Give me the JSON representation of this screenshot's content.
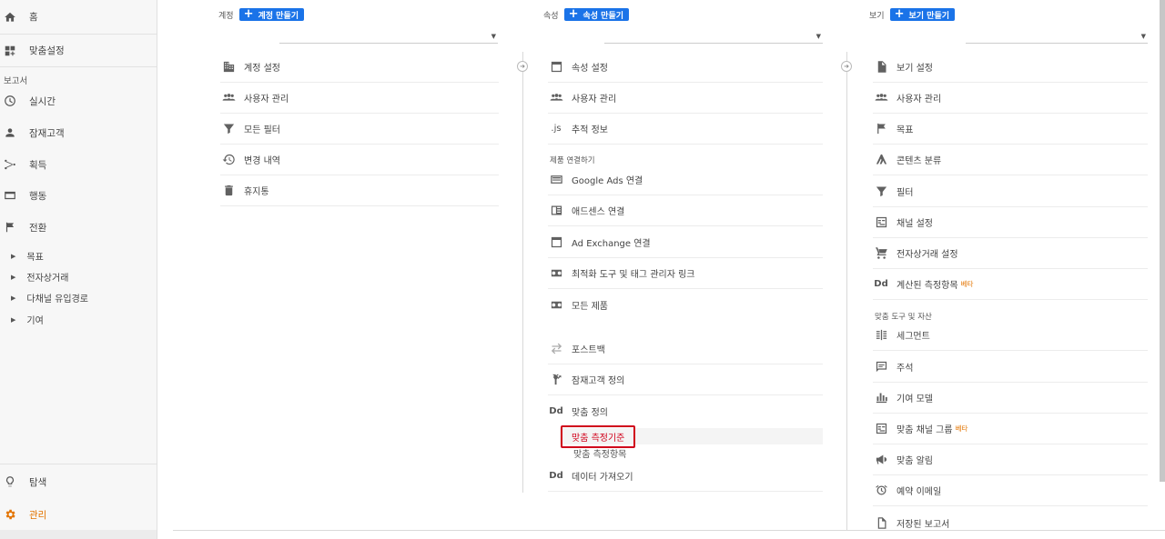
{
  "sidebar": {
    "home": "홈",
    "custom": "맞춤설정",
    "reports_label": "보고서",
    "realtime": "실시간",
    "audience": "잠재고객",
    "acquisition": "획득",
    "behavior": "행동",
    "conversions": "전환",
    "sub": [
      "목표",
      "전자상거래",
      "다채널 유입경로",
      "기여"
    ],
    "explore": "탐색",
    "admin": "관리"
  },
  "account": {
    "label": "계정",
    "create": "계정 만들기",
    "items": [
      "계정 설정",
      "사용자 관리",
      "모든 필터",
      "변경 내역",
      "휴지통"
    ]
  },
  "property": {
    "label": "속성",
    "create": "속성 만들기",
    "items": [
      "속성 설정",
      "사용자 관리",
      "추적 정보"
    ],
    "linking_label": "제품 연결하기",
    "links": [
      "Google Ads 연결",
      "애드센스 연결",
      "Ad Exchange 연결",
      "최적화 도구 및 태그 관리자 링크",
      "모든 제품"
    ],
    "more": [
      "포스트백",
      "잠재고객 정의",
      "맞춤 정의"
    ],
    "custom_metrics": "맞춤 측정기준",
    "custom_metrics2": "맞춤 측정항목",
    "data_import": "데이터 가져오기",
    "js_icon": ".js",
    "dd_icon": "Dd"
  },
  "view": {
    "label": "보기",
    "create": "보기 만들기",
    "items": [
      "보기 설정",
      "사용자 관리",
      "목표",
      "콘텐츠 분류",
      "필터",
      "채널 설정",
      "전자상거래 설정",
      "계산된 측정항목"
    ],
    "beta": "베타",
    "tools_label": "맞춤 도구 및 자산",
    "tools": [
      "세그먼트",
      "주석",
      "기여 모델",
      "맞춤 채널 그룹",
      "맞춤 알림",
      "예약 이메일",
      "저장된 보고서"
    ],
    "dd_icon": "Dd"
  },
  "colors": {
    "accent": "#1a73e8",
    "admin": "#e37400",
    "highlight": "#d0021b"
  }
}
